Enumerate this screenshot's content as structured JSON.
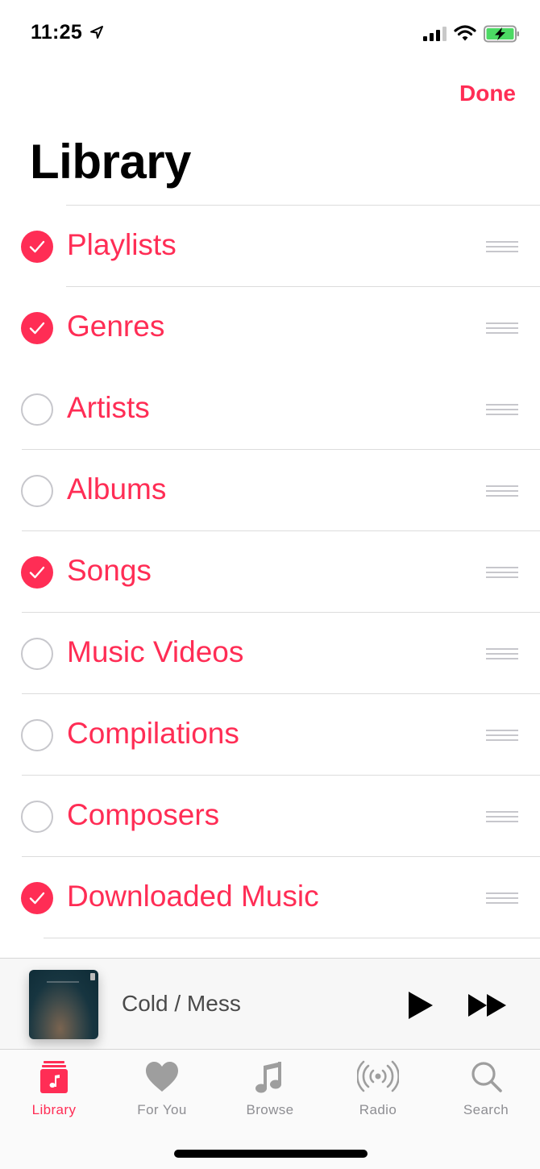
{
  "status_bar": {
    "time": "11:25",
    "location_icon": "location-arrow-icon",
    "signal_icon": "cellular-signal-icon",
    "signal_bars": 3,
    "signal_bars_total": 4,
    "wifi_icon": "wifi-icon",
    "battery_icon": "battery-charging-icon",
    "battery_color": "#4cd964"
  },
  "header": {
    "done_label": "Done",
    "title": "Library"
  },
  "accent_color": "#ff2d55",
  "library_items": [
    {
      "label": "Playlists",
      "checked": true
    },
    {
      "label": "Genres",
      "checked": true
    },
    {
      "label": "Artists",
      "checked": false
    },
    {
      "label": "Albums",
      "checked": false
    },
    {
      "label": "Songs",
      "checked": true
    },
    {
      "label": "Music Videos",
      "checked": false
    },
    {
      "label": "Compilations",
      "checked": false
    },
    {
      "label": "Composers",
      "checked": false
    },
    {
      "label": "Downloaded Music",
      "checked": true
    }
  ],
  "mini_player": {
    "track_title": "Cold / Mess",
    "play_icon": "play-icon",
    "forward_icon": "fast-forward-icon"
  },
  "tabs": [
    {
      "label": "Library",
      "icon": "library-icon",
      "active": true
    },
    {
      "label": "For You",
      "icon": "heart-icon",
      "active": false
    },
    {
      "label": "Browse",
      "icon": "music-note-icon",
      "active": false
    },
    {
      "label": "Radio",
      "icon": "radio-broadcast-icon",
      "active": false
    },
    {
      "label": "Search",
      "icon": "search-icon",
      "active": false
    }
  ]
}
